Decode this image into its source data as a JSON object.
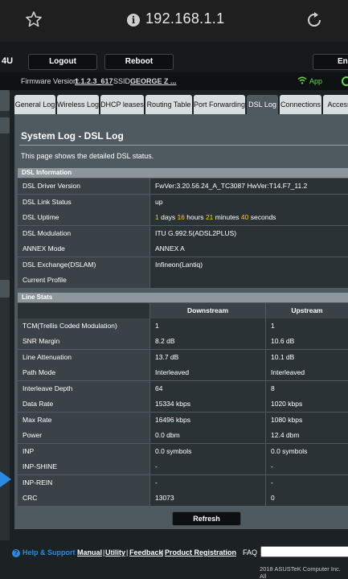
{
  "browser": {
    "url": "192.168.1.1"
  },
  "header": {
    "logo_fragment": "4U",
    "logout_label": "Logout",
    "reboot_label": "Reboot",
    "language_label": "Engl"
  },
  "status_bar": {
    "firmware_label": "Firmware Version:",
    "firmware_value": "1.1.2.3_617",
    "ssid_label": "SSID:",
    "ssid_value": "GEORGE Z ...",
    "app_label": "App"
  },
  "tabs": [
    {
      "label": "General Log"
    },
    {
      "label": "Wireless Log"
    },
    {
      "label": "DHCP leases"
    },
    {
      "label": "Routing Table"
    },
    {
      "label": "Port Forwarding"
    },
    {
      "label": "DSL Log"
    },
    {
      "label": "Connections"
    },
    {
      "label": "Access"
    }
  ],
  "page": {
    "title": "System Log - DSL Log",
    "description": "This page shows the detailed DSL status."
  },
  "dsl_info": {
    "heading": "DSL Information",
    "rows": [
      {
        "label": "DSL Driver Version",
        "value": "FwVer:3.20.56.24_A_TC3087 HwVer:T14.F7_11.2"
      },
      {
        "label": "DSL Link Status",
        "value": "up"
      },
      {
        "label": "DSL Uptime",
        "value": ""
      },
      {
        "label": "DSL Modulation",
        "value": "ITU G.992.5(ADSL2PLUS)"
      },
      {
        "label": "ANNEX Mode",
        "value": "ANNEX A"
      },
      {
        "label": "DSL Exchange(DSLAM)",
        "value": "Infineon(Lantiq)"
      },
      {
        "label": "Current Profile",
        "value": ""
      }
    ],
    "uptime": {
      "days": "1",
      "days_unit": "days",
      "hours": "16",
      "hours_unit": "hours",
      "minutes": "21",
      "minutes_unit": "minutes",
      "seconds": "40",
      "seconds_unit": "seconds"
    }
  },
  "line_stats": {
    "heading": "Line Stats",
    "col_downstream": "Downstream",
    "col_upstream": "Upstream",
    "rows": [
      {
        "label": "TCM(Trellis Coded Modulation)",
        "down": "1",
        "up": "1"
      },
      {
        "label": "SNR Margin",
        "down": "8.2 dB",
        "up": "10.6 dB"
      },
      {
        "label": "Line Attenuation",
        "down": "13.7 dB",
        "up": "10.1 dB"
      },
      {
        "label": "Path Mode",
        "down": "Interleaved",
        "up": "Interleaved"
      },
      {
        "label": "Interleave Depth",
        "down": "64",
        "up": "8"
      },
      {
        "label": "Data Rate",
        "down": "15334 kbps",
        "up": "1020 kbps"
      },
      {
        "label": "Max Rate",
        "down": "16496 kbps",
        "up": "1080 kbps"
      },
      {
        "label": "Power",
        "down": "0.0 dbm",
        "up": "12.4 dbm"
      },
      {
        "label": "INP",
        "down": "0.0 symbols",
        "up": "0.0 symbols"
      },
      {
        "label": "INP-SHINE",
        "down": "-",
        "up": "-"
      },
      {
        "label": "INP-REIN",
        "down": "-",
        "up": "-"
      },
      {
        "label": "CRC",
        "down": "13073",
        "up": "0"
      }
    ]
  },
  "refresh_label": "Refresh",
  "footer": {
    "help_label": "Help & Support",
    "manual": "Manual",
    "utility": "Utility",
    "feedback": "Feedback",
    "product_registration": "Product Registration",
    "separator": "|",
    "faq_label": "FAQ",
    "copyright": "2018 ASUSTeK Computer Inc. All"
  },
  "colors": {
    "accent": "#2a8ae6",
    "panel": "#4e5a60",
    "highlight": "#ffcc00",
    "app_green": "#66d94b"
  }
}
